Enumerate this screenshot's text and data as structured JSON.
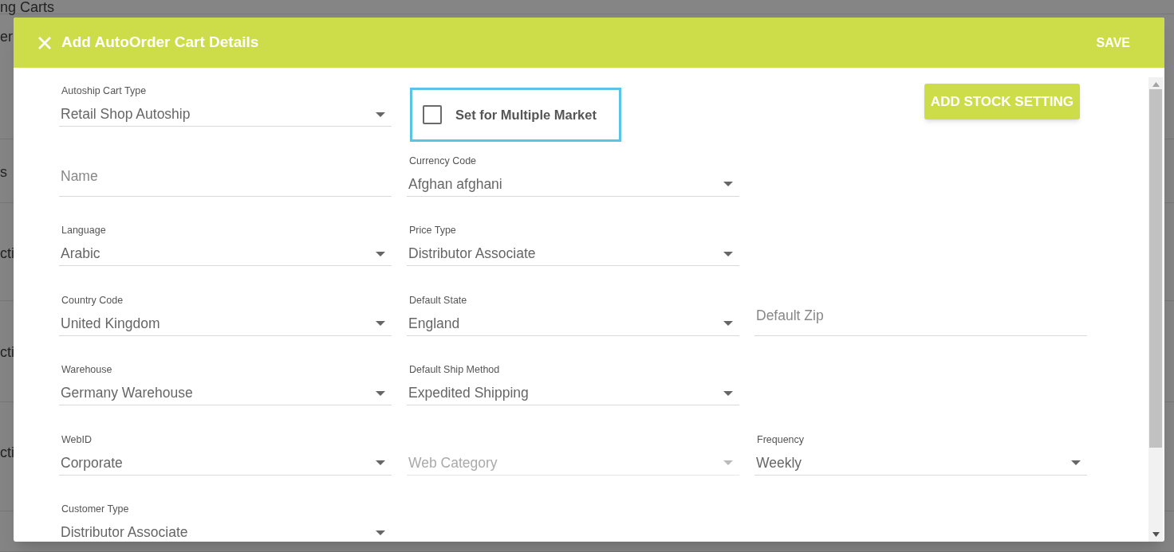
{
  "background": {
    "header_text": "ng Carts",
    "rows": [
      "er",
      "s",
      "cti",
      "cti",
      "cti",
      ""
    ]
  },
  "dialog": {
    "title": "Add AutoOrder Cart Details",
    "save_label": "SAVE",
    "rows": [
      [
        {
          "kind": "select",
          "label": "Autoship Cart Type",
          "value": "Retail Shop Autoship",
          "disabled": false
        },
        {
          "kind": "checkbox",
          "label": "Set for Multiple Market",
          "checked": false,
          "focused": true
        },
        {
          "kind": "button",
          "label": "ADD STOCK SETTING"
        }
      ],
      [
        {
          "kind": "input",
          "placeholder": "Name"
        },
        {
          "kind": "select",
          "label": "Currency Code",
          "value": "Afghan afghani",
          "disabled": false
        },
        {
          "kind": "empty"
        }
      ],
      [
        {
          "kind": "select",
          "label": "Language",
          "value": "Arabic",
          "disabled": false
        },
        {
          "kind": "select",
          "label": "Price Type",
          "value": "Distributor Associate",
          "disabled": false
        },
        {
          "kind": "empty"
        }
      ],
      [
        {
          "kind": "select",
          "label": "Country Code",
          "value": "United Kingdom",
          "disabled": false
        },
        {
          "kind": "select",
          "label": "Default State",
          "value": "England",
          "disabled": false
        },
        {
          "kind": "input",
          "placeholder": "Default Zip"
        }
      ],
      [
        {
          "kind": "select",
          "label": "Warehouse",
          "value": "Germany Warehouse",
          "disabled": false
        },
        {
          "kind": "select",
          "label": "Default Ship Method",
          "value": "Expedited Shipping",
          "disabled": false
        },
        {
          "kind": "empty"
        }
      ],
      [
        {
          "kind": "select",
          "label": "WebID",
          "value": "Corporate",
          "disabled": false
        },
        {
          "kind": "select",
          "placeholder": "Web Category",
          "disabled": true
        },
        {
          "kind": "select",
          "label": "Frequency",
          "value": "Weekly",
          "disabled": false
        }
      ],
      [
        {
          "kind": "select",
          "label": "Customer Type",
          "value": "Distributor Associate",
          "disabled": false
        },
        {
          "kind": "empty"
        },
        {
          "kind": "empty"
        }
      ]
    ]
  }
}
